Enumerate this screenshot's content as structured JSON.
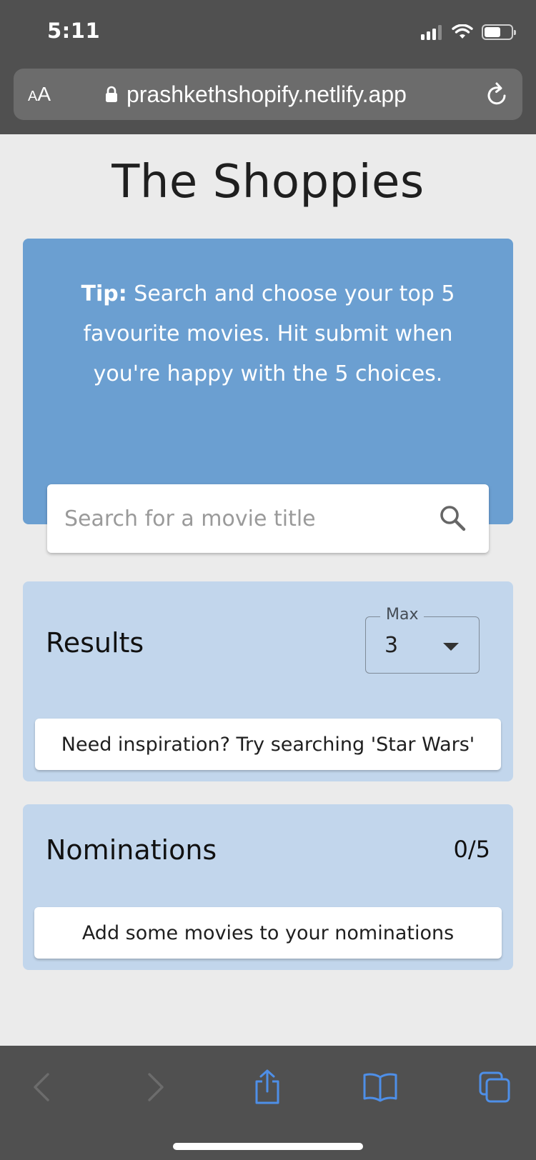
{
  "status_bar": {
    "time": "5:11",
    "icons": [
      "cellular-signal-icon",
      "wifi-icon",
      "battery-icon"
    ]
  },
  "browser": {
    "text_size_label_small": "A",
    "text_size_label_large": "A",
    "url": "prashkethshopify.netlify.app",
    "icons": [
      "lock-icon",
      "reload-icon"
    ]
  },
  "page": {
    "title": "The Shoppies",
    "tip": {
      "label": "Tip:",
      "text": " Search and choose your top 5 favourite movies. Hit submit when you're happy with the 5 choices."
    },
    "search": {
      "placeholder": "Search for a movie title",
      "value": ""
    },
    "results": {
      "title": "Results",
      "max_label": "Max",
      "max_value": "3",
      "hint": "Need inspiration? Try searching 'Star Wars'"
    },
    "nominations": {
      "title": "Nominations",
      "count": "0/5",
      "empty_message": "Add some movies to your nominations"
    }
  },
  "toolbar": {
    "icons": [
      "back-icon",
      "forward-icon",
      "share-icon",
      "bookmarks-icon",
      "tabs-icon"
    ]
  },
  "colors": {
    "chrome_bg": "#505050",
    "page_bg": "#ebebeb",
    "tip_card": "#6b9fd1",
    "section_card": "#c2d6ec",
    "toolbar_accent": "#4e8fe8"
  }
}
